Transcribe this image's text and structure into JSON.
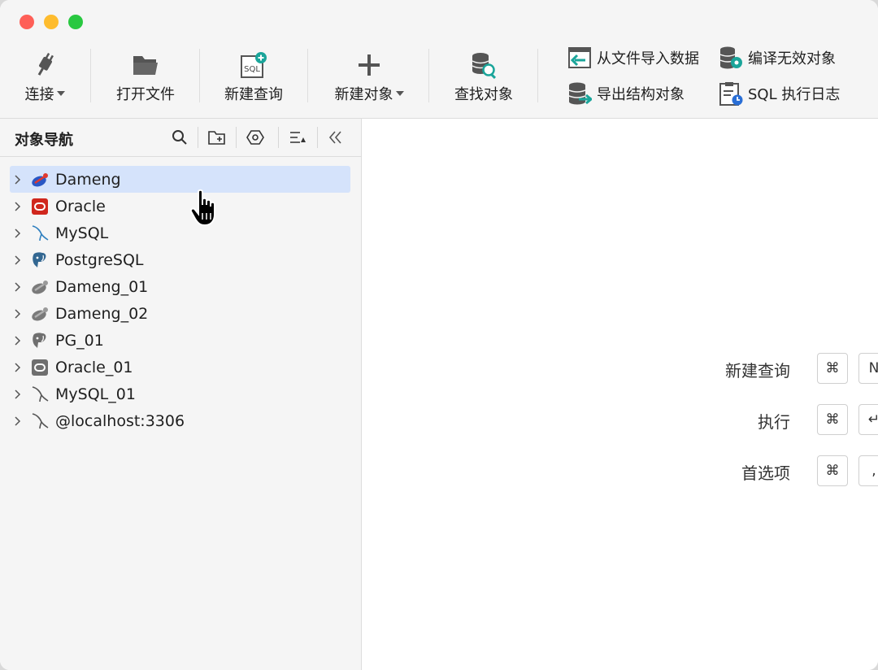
{
  "toolbar": {
    "connect": "连接",
    "open_file": "打开文件",
    "new_query": "新建查询",
    "new_object": "新建对象",
    "find_object": "查找对象",
    "import_data": "从文件导入数据",
    "export_structure": "导出结构对象",
    "compile_invalid": "编译无效对象",
    "sql_log": "SQL 执行日志",
    "sql_badge": "SQL"
  },
  "sidebar": {
    "title": "对象导航",
    "items": [
      {
        "label": "Dameng",
        "icon": "dameng-icon",
        "selected": true
      },
      {
        "label": "Oracle",
        "icon": "oracle-icon"
      },
      {
        "label": "MySQL",
        "icon": "mysql-icon"
      },
      {
        "label": "PostgreSQL",
        "icon": "postgresql-icon"
      },
      {
        "label": "Dameng_01",
        "icon": "dameng-gray-icon"
      },
      {
        "label": "Dameng_02",
        "icon": "dameng-gray-icon"
      },
      {
        "label": "PG_01",
        "icon": "postgresql-gray-icon"
      },
      {
        "label": "Oracle_01",
        "icon": "oracle-gray-icon"
      },
      {
        "label": "MySQL_01",
        "icon": "mysql-gray-icon"
      },
      {
        "label": "@localhost:3306",
        "icon": "mysql-gray-icon"
      }
    ]
  },
  "shortcuts": [
    {
      "label": "新建查询",
      "key1": "⌘",
      "key2": "N"
    },
    {
      "label": "执行",
      "key1": "⌘",
      "key2": "↵"
    },
    {
      "label": "首选项",
      "key1": "⌘",
      "key2": ","
    }
  ],
  "colors": {
    "accent_teal": "#1aa59a",
    "selection": "#d5e3fb",
    "oracle_red": "#d0271d",
    "dameng_blue": "#2a57c4"
  }
}
